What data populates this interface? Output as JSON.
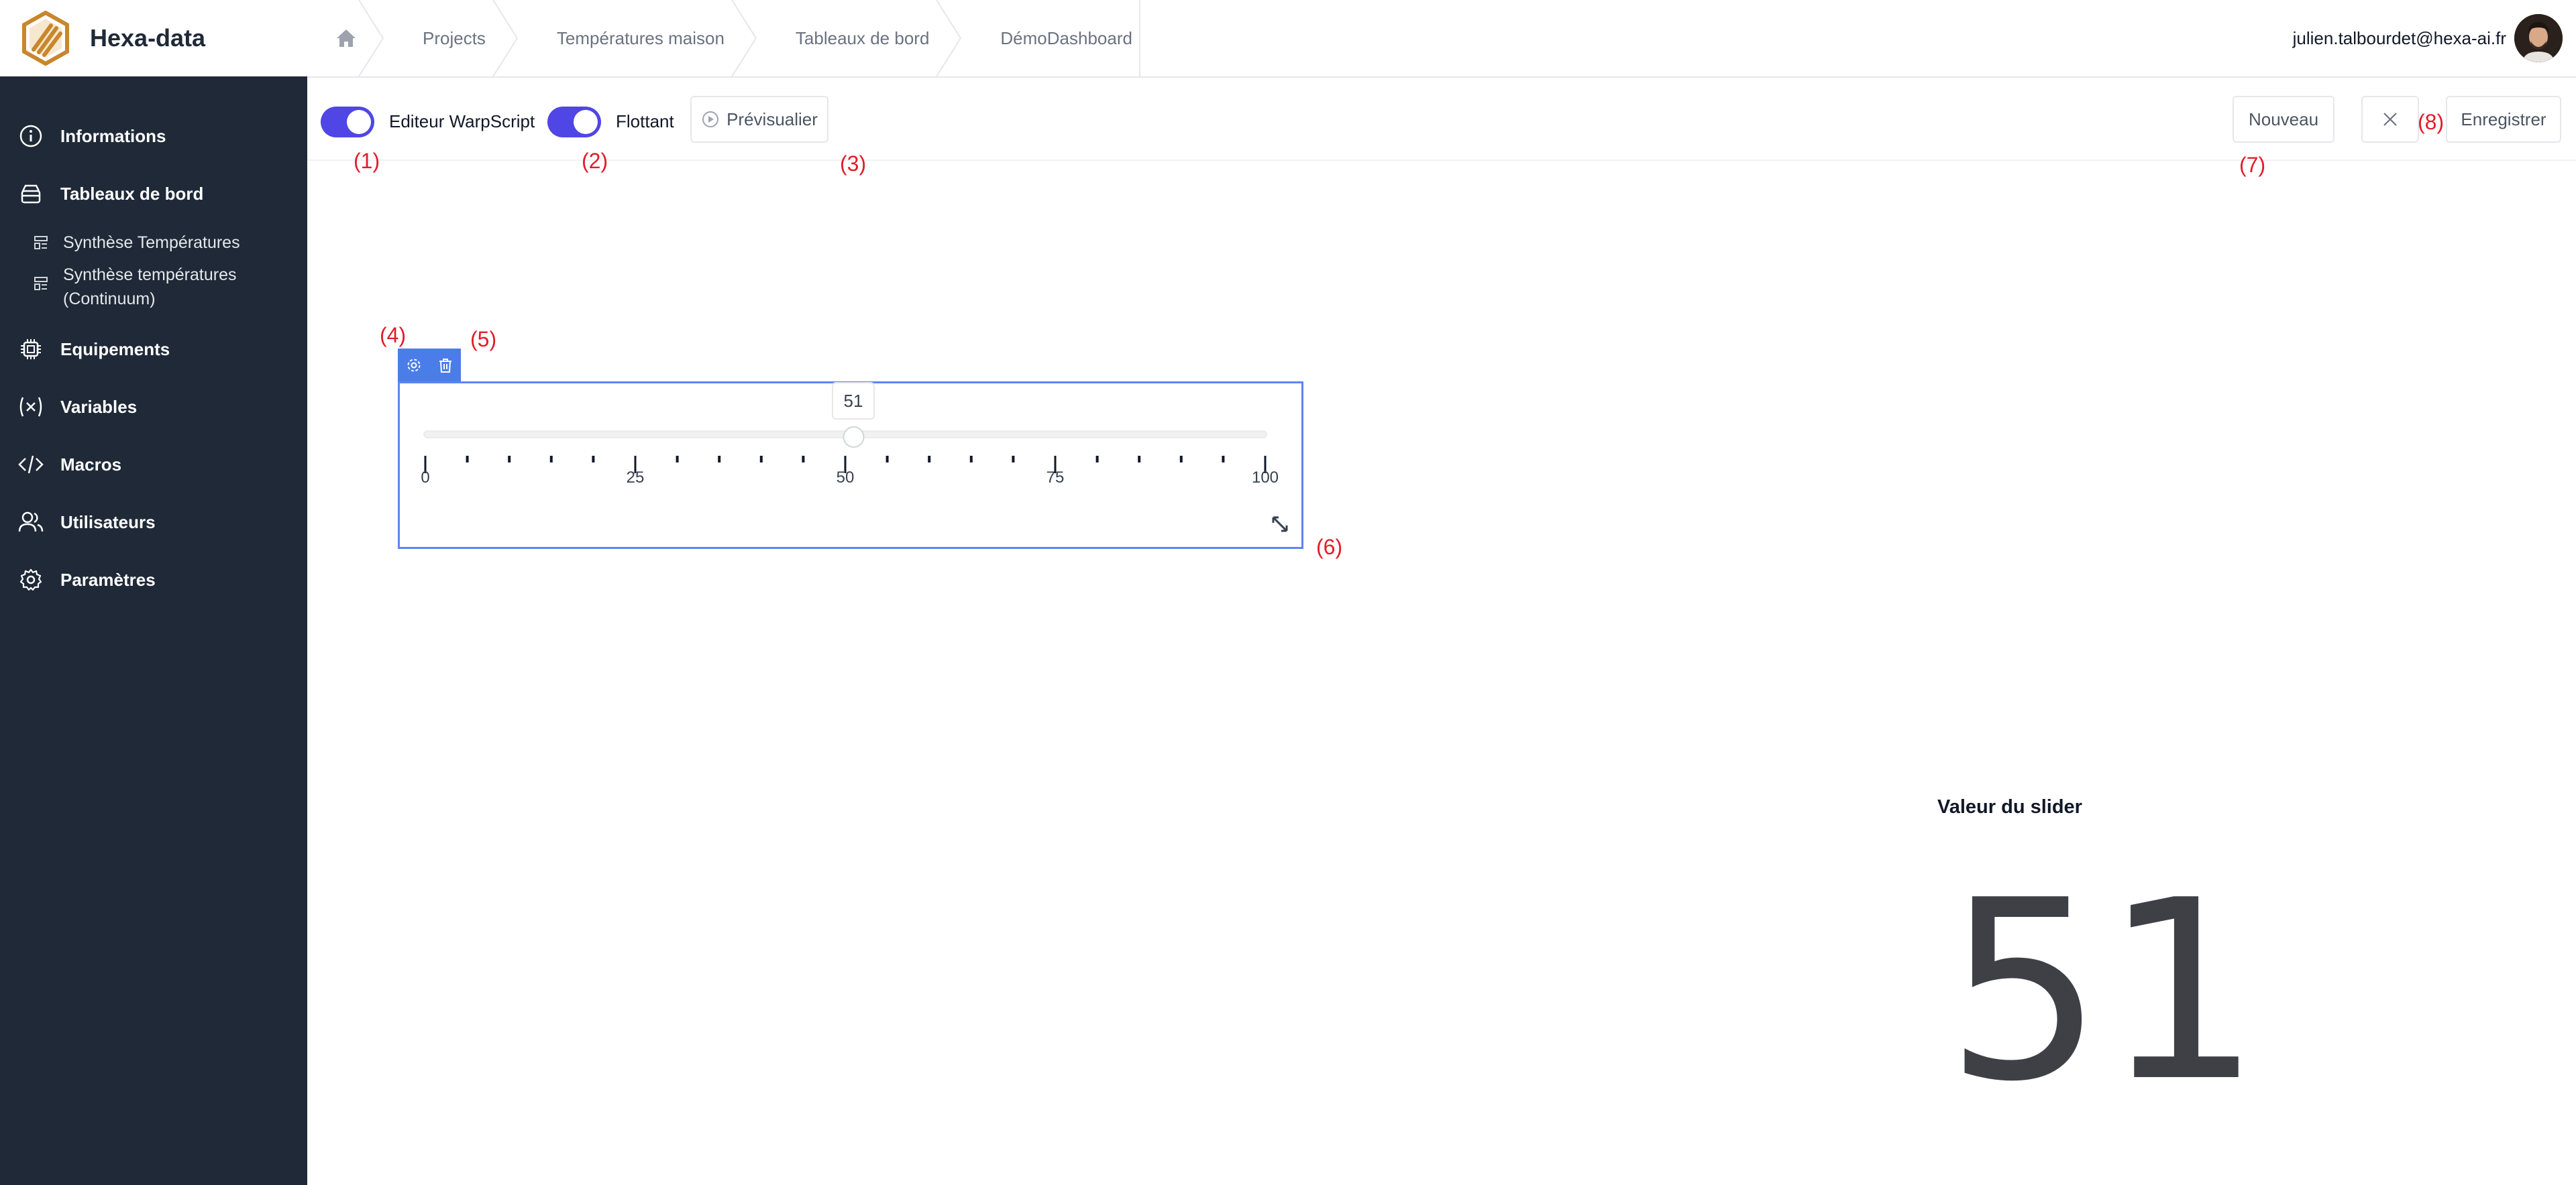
{
  "app": {
    "name": "Hexa-data"
  },
  "breadcrumbs": [
    "Projects",
    "Températures maison",
    "Tableaux de bord",
    "DémoDashboard"
  ],
  "user": {
    "email": "julien.talbourdet@hexa-ai.fr"
  },
  "sidebar": {
    "items": [
      {
        "label": "Informations",
        "icon": "info-icon"
      },
      {
        "label": "Tableaux de bord",
        "icon": "dashboard-icon"
      },
      {
        "label": "Synthèse Températures",
        "icon": "layout-icon"
      },
      {
        "label_line1": "Synthèse températures",
        "label_line2": "(Continuum)",
        "icon": "layout-icon"
      },
      {
        "label": "Equipements",
        "icon": "chip-icon"
      },
      {
        "label": "Variables",
        "icon": "variable-icon"
      },
      {
        "label": "Macros",
        "icon": "code-icon"
      },
      {
        "label": "Utilisateurs",
        "icon": "users-icon"
      },
      {
        "label": "Paramètres",
        "icon": "gear-icon"
      }
    ]
  },
  "toolbar": {
    "toggle_warpscript": {
      "label": "Editeur WarpScript",
      "on": true
    },
    "toggle_floating": {
      "label": "Flottant",
      "on": true
    },
    "preview_label": "Prévisualier",
    "new_label": "Nouveau",
    "save_label": "Enregistrer"
  },
  "annotations": [
    "(1)",
    "(2)",
    "(3)",
    "(4)",
    "(5)",
    "(6)",
    "(7)",
    "(8)"
  ],
  "slider": {
    "min": 0,
    "max": 100,
    "value": 51,
    "value_label": "51",
    "ticks": [
      "0",
      "25",
      "50",
      "75",
      "100"
    ]
  },
  "value_widget": {
    "title": "Valeur du slider",
    "value": "51"
  },
  "colors": {
    "sidebar_bg": "#1f2937",
    "accent": "#4f46e5",
    "widget_border": "#5b86f0",
    "annotation": "#e11d2a",
    "logo": "#c9862b"
  }
}
